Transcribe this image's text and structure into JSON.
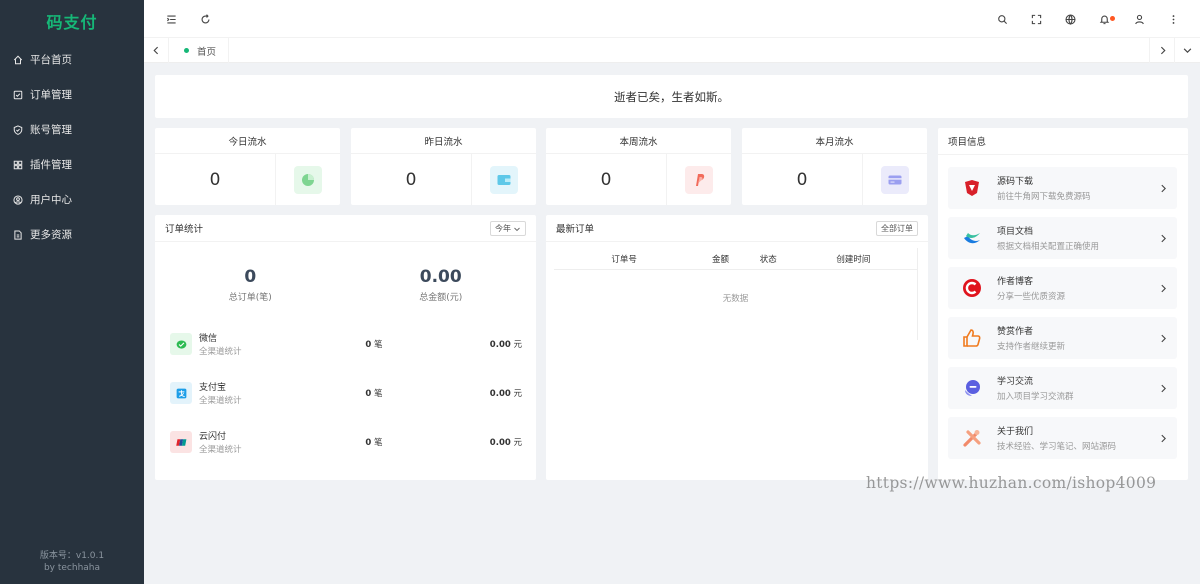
{
  "app": {
    "logo": "码支付"
  },
  "sidebar": {
    "items": [
      {
        "label": "平台首页",
        "icon": "home-icon"
      },
      {
        "label": "订单管理",
        "icon": "order-icon"
      },
      {
        "label": "账号管理",
        "icon": "shield-icon"
      },
      {
        "label": "插件管理",
        "icon": "grid-icon"
      },
      {
        "label": "用户中心",
        "icon": "user-circle-icon"
      },
      {
        "label": "更多资源",
        "icon": "file-icon"
      }
    ],
    "version_line1": "版本号：v1.0.1",
    "version_line2": "by techhaha"
  },
  "header": {
    "left_icons": [
      "menu-fold-icon",
      "refresh-icon"
    ],
    "right_icons": [
      "search-icon",
      "fullscreen-icon",
      "globe-icon",
      "bell-icon",
      "user-icon",
      "more-icon"
    ]
  },
  "tabs": {
    "items": [
      {
        "label": "首页"
      }
    ]
  },
  "banner": {
    "text": "逝者已矣，生者如斯。"
  },
  "stats": [
    {
      "title": "今日流水",
      "value": "0",
      "icon": "pie-chart-icon",
      "color": "#e6f8ea"
    },
    {
      "title": "昨日流水",
      "value": "0",
      "icon": "wallet-icon",
      "color": "#e3f5fb"
    },
    {
      "title": "本周流水",
      "value": "0",
      "icon": "paypal-icon",
      "color": "#fdebeb"
    },
    {
      "title": "本月流水",
      "value": "0",
      "icon": "card-icon",
      "color": "#ebebfb"
    }
  ],
  "order_stats": {
    "title": "订单统计",
    "period": "今年",
    "total_orders": "0",
    "total_orders_label": "总订单(笔)",
    "total_amount": "0.00",
    "total_amount_label": "总金额(元)",
    "channels": [
      {
        "name": "微信",
        "sub": "全渠道统计",
        "count": "0",
        "count_unit": "笔",
        "amount": "0.00",
        "amount_unit": "元",
        "icon": "wechat-icon"
      },
      {
        "name": "支付宝",
        "sub": "全渠道统计",
        "count": "0",
        "count_unit": "笔",
        "amount": "0.00",
        "amount_unit": "元",
        "icon": "alipay-icon"
      },
      {
        "name": "云闪付",
        "sub": "全渠道统计",
        "count": "0",
        "count_unit": "笔",
        "amount": "0.00",
        "amount_unit": "元",
        "icon": "unionpay-icon"
      }
    ]
  },
  "latest_orders": {
    "title": "最新订单",
    "all_button": "全部订单",
    "columns": [
      "订单号",
      "金额",
      "状态",
      "创建时间"
    ],
    "empty": "无数据"
  },
  "project": {
    "title": "项目信息",
    "items": [
      {
        "title": "源码下载",
        "desc": "前往牛角网下载免费源码",
        "icon": "download-logo-icon"
      },
      {
        "title": "项目文档",
        "desc": "根据文档相关配置正确使用",
        "icon": "docs-logo-icon"
      },
      {
        "title": "作者博客",
        "desc": "分享一些优质资源",
        "icon": "blog-logo-icon"
      },
      {
        "title": "赞赏作者",
        "desc": "支持作者继续更新",
        "icon": "thumbs-up-icon"
      },
      {
        "title": "学习交流",
        "desc": "加入项目学习交流群",
        "icon": "chat-icon"
      },
      {
        "title": "关于我们",
        "desc": "技术经验、学习笔记、网站源码",
        "icon": "tools-icon"
      }
    ]
  },
  "watermark": "https://www.huzhan.com/ishop4009"
}
